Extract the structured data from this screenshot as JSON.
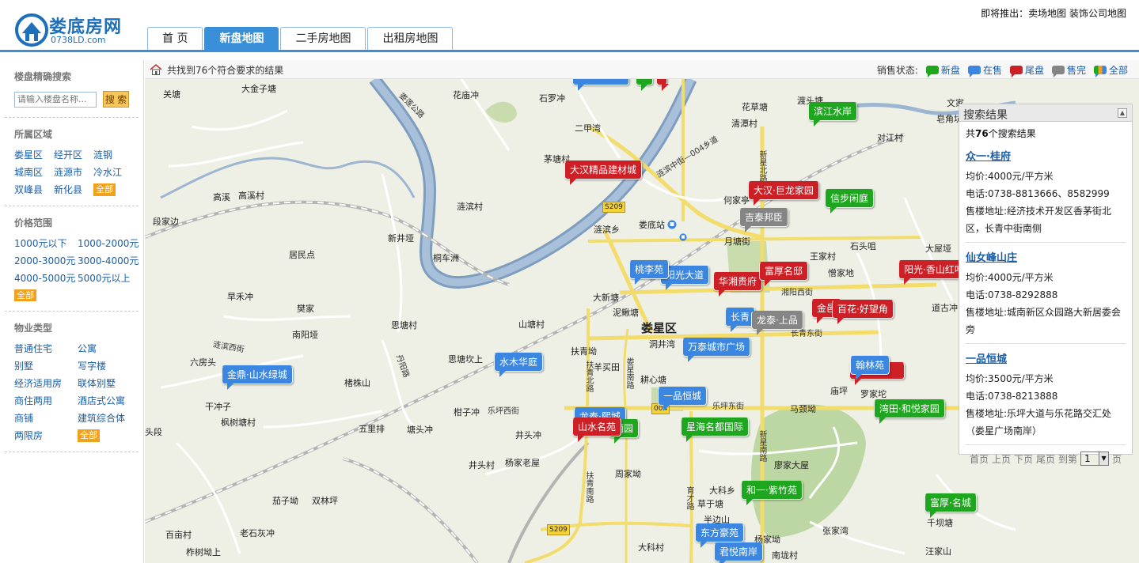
{
  "header": {
    "logo_name": "娄底房网",
    "logo_domain": "0738LD.com",
    "nav": [
      {
        "label": "首 页",
        "active": false
      },
      {
        "label": "新盘地图",
        "active": true
      },
      {
        "label": "二手房地图",
        "active": false
      },
      {
        "label": "出租房地图",
        "active": false
      }
    ],
    "note": "即将推出：卖场地图 装饰公司地图"
  },
  "sidebar": {
    "search_title": "楼盘精确搜索",
    "search_placeholder": "请输入楼盘名称...",
    "search_button": "搜 索",
    "region_title": "所属区域",
    "regions": [
      "娄星区",
      "经开区",
      "涟钢",
      "城南区",
      "涟源市",
      "冷水江",
      "双峰县",
      "新化县"
    ],
    "region_all": "全部",
    "price_title": "价格范围",
    "prices": [
      "1000元以下",
      "1000-2000元",
      "2000-3000元",
      "3000-4000元",
      "4000-5000元",
      "5000元以上"
    ],
    "price_all": "全部",
    "type_title": "物业类型",
    "types": [
      "普通住宅",
      "公寓",
      "别墅",
      "写字楼",
      "经济适用房",
      "联体别墅",
      "商住两用",
      "酒店式公寓",
      "商铺",
      "建筑综合体",
      "两限房"
    ],
    "type_all": "全部"
  },
  "map_bar": {
    "result_text": "共找到76个符合要求的结果",
    "status_label": "销售状态:",
    "legend": [
      {
        "label": "新盘",
        "color": "#1ea61e"
      },
      {
        "label": "在售",
        "color": "#3a86e0"
      },
      {
        "label": "尾盘",
        "color": "#cc1f26"
      },
      {
        "label": "售完",
        "color": "#858585"
      },
      {
        "label": "全部",
        "color": "#f0a21e"
      }
    ]
  },
  "map": {
    "district": "娄星区",
    "places": [
      "关塘",
      "大金子塘",
      "花庙冲",
      "石罗冲",
      "二甲湾",
      "茅塘村",
      "花草塘",
      "清潭村",
      "渡头塘",
      "对江村",
      "文家",
      "皂角坑",
      "高溪",
      "高溪村",
      "段家边",
      "涟滨村",
      "新井垭",
      "桐车洲",
      "居民点",
      "涟滨乡",
      "娄底站",
      "何家亭",
      "月塘街",
      "石头咀",
      "王家村",
      "大屋垭",
      "憎家地",
      "早禾冲",
      "樊家",
      "南阳垭",
      "大新塘",
      "泥鳅塘",
      "思塘村",
      "山塘村",
      "六房头",
      "洞井湾",
      "扶青坳",
      "羊买田",
      "耕心塘",
      "思塘坎上",
      "楮株山",
      "干冲子",
      "枫树塘村",
      "五里排",
      "塘头冲",
      "柑子冲",
      "庙坪",
      "罗家坨",
      "马颈坳",
      "道古冲",
      "井头冲",
      "井头村",
      "杨家老屋",
      "周家坳",
      "廖家大屋",
      "茄子坳",
      "双林坪",
      "大科乡",
      "草于塘",
      "半边山",
      "杨家坳",
      "张家湾",
      "千坝塘",
      "老石灰冲",
      "百亩村",
      "柞树坳上",
      "大科村",
      "南垅村",
      "汪家山",
      "头段"
    ],
    "roads": [
      "涟滨中街—004乡道",
      "湘阳西街",
      "长青东街",
      "乐坪西街",
      "乐坪东街",
      "涟滨西街",
      "新星北路",
      "新星南路",
      "扶青北路",
      "扶青南路",
      "娄星南路",
      "育才路",
      "丹阳路",
      "娄莲公路"
    ],
    "road_badges": [
      "S209",
      "S209",
      "004"
    ],
    "markers": [
      {
        "label": "滨江水岸",
        "status": "green"
      },
      {
        "label": "大汉精品建材城",
        "status": "red"
      },
      {
        "label": "大汉·巨龙家园",
        "status": "red"
      },
      {
        "label": "信步闲庭",
        "status": "green"
      },
      {
        "label": "吉泰邦臣",
        "status": "gray"
      },
      {
        "label": "桃李苑",
        "status": "blue"
      },
      {
        "label": "阳光大道",
        "status": "blue"
      },
      {
        "label": "华湘贵府",
        "status": "red"
      },
      {
        "label": "富厚名邸",
        "status": "red"
      },
      {
        "label": "阳光·香山红叶",
        "status": "red"
      },
      {
        "label": "长青",
        "status": "blue"
      },
      {
        "label": "龙泰·上品",
        "status": "gray"
      },
      {
        "label": "金邑",
        "status": "red"
      },
      {
        "label": "百花·好望角",
        "status": "red"
      },
      {
        "label": "万泰城市广场",
        "status": "blue"
      },
      {
        "label": "水木华庭",
        "status": "blue"
      },
      {
        "label": "金鼎·山水绿城",
        "status": "blue"
      },
      {
        "label": "翰林苑",
        "status": "blue"
      },
      {
        "label": "一品恒城",
        "status": "blue"
      },
      {
        "label": "湾田·和悦家园",
        "status": "green"
      },
      {
        "label": "龙泰·熙城",
        "status": "blue"
      },
      {
        "label": "山水名苑",
        "status": "red"
      },
      {
        "label": "丽园",
        "status": "green"
      },
      {
        "label": "星海名都国际",
        "status": "green"
      },
      {
        "label": "和一·紫竹苑",
        "status": "green"
      },
      {
        "label": "富厚·名城",
        "status": "green"
      },
      {
        "label": "东方豪苑",
        "status": "blue"
      },
      {
        "label": "君悦南岸",
        "status": "blue"
      }
    ]
  },
  "results": {
    "title": "搜索结果",
    "count_prefix": "共",
    "count": "76",
    "count_suffix": "个搜索结果",
    "items": [
      {
        "name": "众一·桂府",
        "price": "均价:4000元/平方米",
        "phone": "电话:0738-8813666、8582999",
        "address": "售楼地址:经济技术开发区香茅街北区，长青中街南侧"
      },
      {
        "name": "仙女峰山庄",
        "price": "均价:4000元/平方米",
        "phone": "电话:0738-8292888",
        "address": "售楼地址:城南新区众园路大新居委会旁"
      },
      {
        "name": "一品恒城",
        "price": "均价:3500元/平方米",
        "phone": "电话:0738-8213888",
        "address": "售楼地址:乐坪大道与乐花路交汇处（娄星广场南岸）"
      }
    ],
    "pager": {
      "first": "首页",
      "prev": "上页",
      "next": "下页",
      "last": "尾页",
      "goto": "到第",
      "page": "1",
      "unit": "页"
    }
  }
}
